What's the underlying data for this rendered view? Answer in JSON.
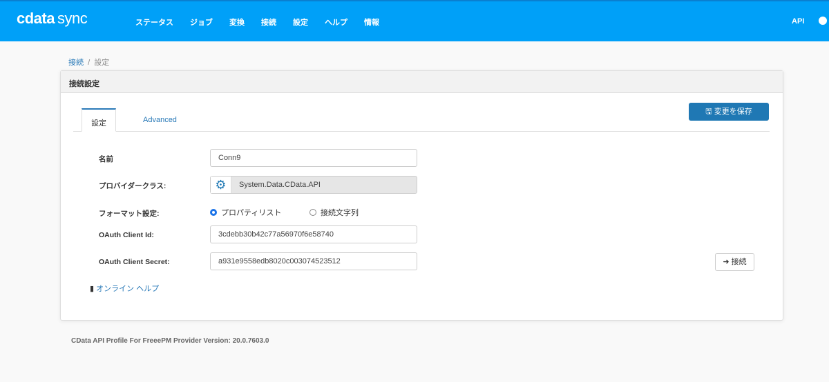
{
  "header": {
    "logo": "cdata",
    "logo_sub": "sync",
    "menu": [
      "ステータス",
      "ジョブ",
      "変換",
      "接続",
      "設定",
      "ヘルプ",
      "情報"
    ],
    "api": "API"
  },
  "breadcrumb": {
    "parent": "接続",
    "sep": "/",
    "current": "設定"
  },
  "panel": {
    "title": "接続設定",
    "tabs": [
      "設定",
      "Advanced"
    ],
    "save": "変更を保存",
    "fields": {
      "name_label": "名前",
      "name_value": "Conn9",
      "provider_label": "プロバイダークラス:",
      "provider_value": "System.Data.CData.API",
      "format_label": "フォーマット設定:",
      "format_opt1": "プロパティリスト",
      "format_opt2": "接続文字列",
      "client_id_label": "OAuth Client Id:",
      "client_id_value": "3cdebb30b42c77a56970f6e58740",
      "client_secret_label": "OAuth Client Secret:",
      "client_secret_value": "a931e9558edb8020c003074523512"
    },
    "connect": "接続",
    "help": "オンライン ヘルプ"
  },
  "footer": "CData API Profile For FreeePM Provider Version: 20.0.7603.0"
}
